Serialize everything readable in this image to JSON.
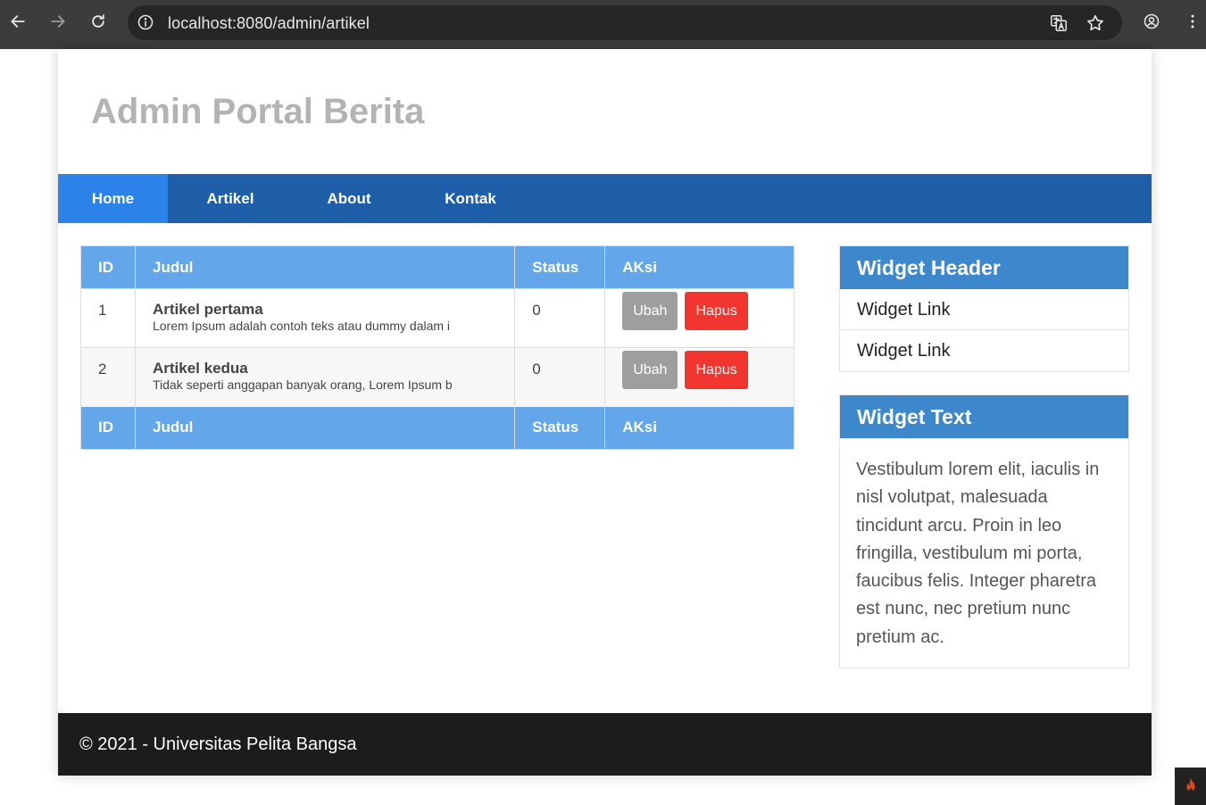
{
  "browser": {
    "url": "localhost:8080/admin/artikel"
  },
  "site": {
    "title": "Admin Portal Berita"
  },
  "nav": {
    "items": [
      {
        "label": "Home"
      },
      {
        "label": "Artikel"
      },
      {
        "label": "About"
      },
      {
        "label": "Kontak"
      }
    ]
  },
  "table": {
    "headers": [
      "ID",
      "Judul",
      "Status",
      "AKsi"
    ],
    "rows": [
      {
        "id": "1",
        "title": "Artikel pertama",
        "desc": "Lorem Ipsum adalah contoh teks atau dummy dalam i",
        "status": "0",
        "edit": "Ubah",
        "delete": "Hapus"
      },
      {
        "id": "2",
        "title": "Artikel kedua",
        "desc": "Tidak seperti anggapan banyak orang, Lorem Ipsum b",
        "status": "0",
        "edit": "Ubah",
        "delete": "Hapus"
      }
    ],
    "footers": [
      "ID",
      "Judul",
      "Status",
      "AKsi"
    ]
  },
  "widget1": {
    "header": "Widget Header",
    "links": [
      "Widget Link",
      "Widget Link"
    ]
  },
  "widget2": {
    "header": "Widget Text",
    "text": "Vestibulum lorem elit, iaculis in nisl volutpat, malesuada tincidunt arcu. Proin in leo fringilla, vestibulum mi porta, faucibus felis. Integer pharetra est nunc, nec pretium nunc pretium ac."
  },
  "footer": {
    "text": "© 2021 - Universitas Pelita Bangsa"
  },
  "colors": {
    "nav": "#1f5faa",
    "nav_active": "#2b83ea",
    "table_head": "#63a7ea",
    "widget_head": "#3d87cc",
    "btn_edit": "#9e9e9e",
    "btn_delete": "#f2352e",
    "footer": "#1c1c1c"
  },
  "icons": [
    "back-arrow-icon",
    "forward-arrow-icon",
    "reload-icon",
    "site-info-icon",
    "translate-icon",
    "bookmark-star-icon",
    "profile-icon",
    "menu-dots-icon",
    "codeigniter-flame-icon"
  ]
}
